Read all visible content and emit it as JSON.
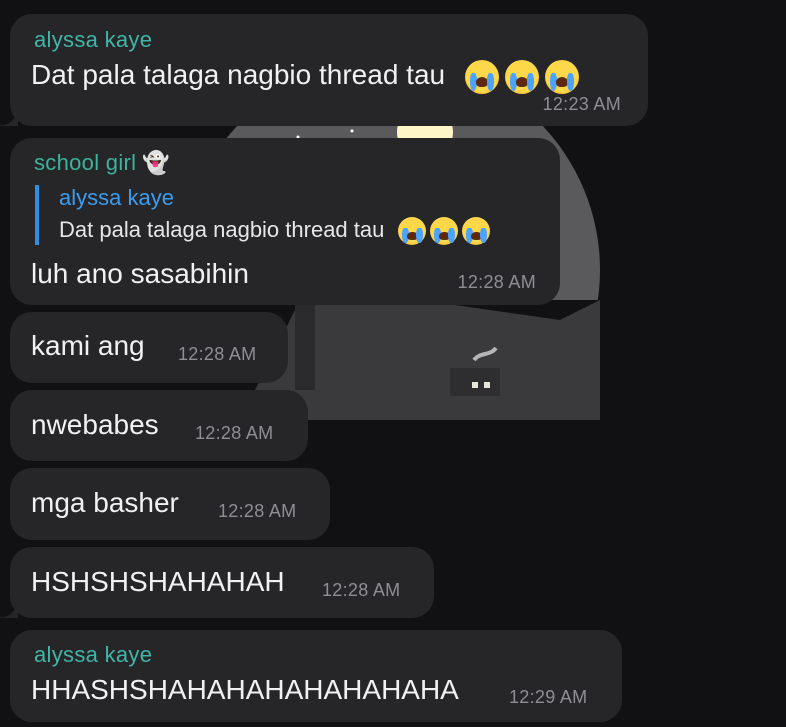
{
  "messages": [
    {
      "sender": "alyssa kaye",
      "text": "Dat pala talaga nagbio thread tau",
      "time": "12:23 AM"
    },
    {
      "sender": "school girl",
      "sender_emoji": "👻",
      "reply": {
        "sender": "alyssa kaye",
        "text": "Dat pala talaga nagbio thread tau"
      },
      "text": "luh ano sasabihin",
      "time": "12:28 AM"
    },
    {
      "text": "kami ang",
      "time": "12:28 AM"
    },
    {
      "text": "nwebabes",
      "time": "12:28 AM"
    },
    {
      "text": "mga basher",
      "time": "12:28 AM"
    },
    {
      "text": "HSHSHSHAHAHAH",
      "time": "12:28 AM"
    },
    {
      "sender": "alyssa kaye",
      "text": "HHASHSHAHAHAHAHAHAHAHA",
      "time": "12:29 AM"
    }
  ],
  "colors": {
    "background": "#111113",
    "bubble": "#262629",
    "sender": "#3fb6a8",
    "reply_bar": "#2f8de4",
    "time": "#8e8e93"
  },
  "icons": {
    "emoji": "loudly-crying-face-icon",
    "ghost": "ghost-icon"
  }
}
